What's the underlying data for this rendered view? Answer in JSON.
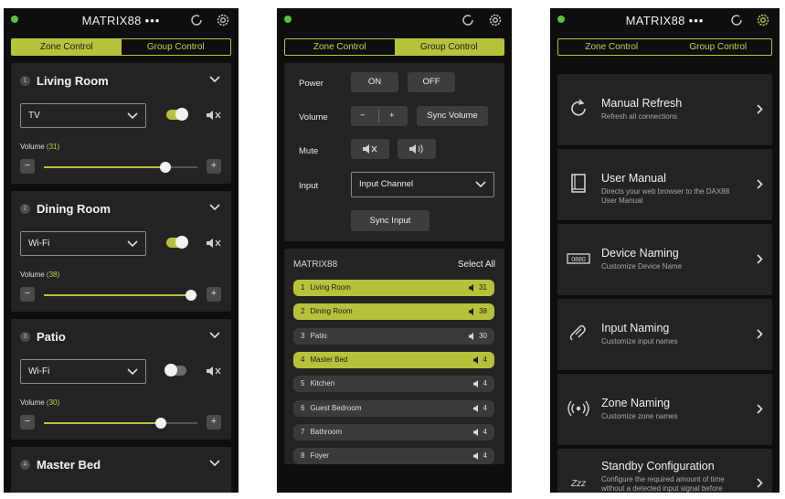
{
  "app": {
    "title": "MATRIX88",
    "more": "•••"
  },
  "tabs": {
    "zone_control": "Zone Control",
    "group_control": "Group Control"
  },
  "colors": {
    "accent": "#b6c23a",
    "status_dot": "#58c43a",
    "card": "#232323",
    "background": "#0e0e0e"
  },
  "screen1": {
    "zones": [
      {
        "num": "1",
        "name": "Living Room",
        "source": "TV",
        "power": true,
        "volume_label": "Volume",
        "volume": "(31)",
        "level": 0.79
      },
      {
        "num": "2",
        "name": "Dining Room",
        "source": "Wi-Fi",
        "power": true,
        "volume_label": "Volume",
        "volume": "(38)",
        "level": 0.96
      },
      {
        "num": "3",
        "name": "Patio",
        "source": "Wi-Fi",
        "power": false,
        "volume_label": "Volume",
        "volume": "(30)",
        "level": 0.76
      },
      {
        "num": "4",
        "name": "Master Bed"
      }
    ],
    "minus": "−",
    "plus": "+"
  },
  "screen2": {
    "power_label": "Power",
    "on": "ON",
    "off": "OFF",
    "volume_label": "Volume",
    "vol_minus": "−",
    "vol_plus": "+",
    "sync_volume": "Sync Volume",
    "mute_label": "Mute",
    "input_label": "Input",
    "input_channel": "Input Channel",
    "sync_input": "Sync Input",
    "list_title": "MATRIX88",
    "select_all": "Select All",
    "zones": [
      {
        "num": "1",
        "name": "Living Room",
        "vol": "31",
        "selected": true
      },
      {
        "num": "2",
        "name": "Dining Room",
        "vol": "38",
        "selected": true
      },
      {
        "num": "3",
        "name": "Patio",
        "vol": "30",
        "selected": false
      },
      {
        "num": "4",
        "name": "Master Bed",
        "vol": "4",
        "selected": true
      },
      {
        "num": "5",
        "name": "Kitchen",
        "vol": "4",
        "selected": false
      },
      {
        "num": "6",
        "name": "Guest Bedroom",
        "vol": "4",
        "selected": false
      },
      {
        "num": "7",
        "name": "Bathroom",
        "vol": "4",
        "selected": false
      },
      {
        "num": "8",
        "name": "Foyer",
        "vol": "4",
        "selected": false
      }
    ]
  },
  "screen3": {
    "items": [
      {
        "title": "Manual Refresh",
        "sub": "Refresh all connections",
        "icon": "refresh-icon"
      },
      {
        "title": "User Manual",
        "sub": "Directs your web browser to the DAX88 User Manual",
        "icon": "book-icon"
      },
      {
        "title": "Device Naming",
        "sub": "Customize Device Name",
        "icon": "device-icon",
        "icon_text": "0880"
      },
      {
        "title": "Input Naming",
        "sub": "Customize input names",
        "icon": "input-cable-icon"
      },
      {
        "title": "Zone Naming",
        "sub": "Customize zone names",
        "icon": "broadcast-icon"
      },
      {
        "title": "Standby Configuration",
        "sub": "Configure the required amount of time without a detected input signal before",
        "icon": "sleep-icon",
        "icon_text": "Zzz"
      }
    ]
  }
}
